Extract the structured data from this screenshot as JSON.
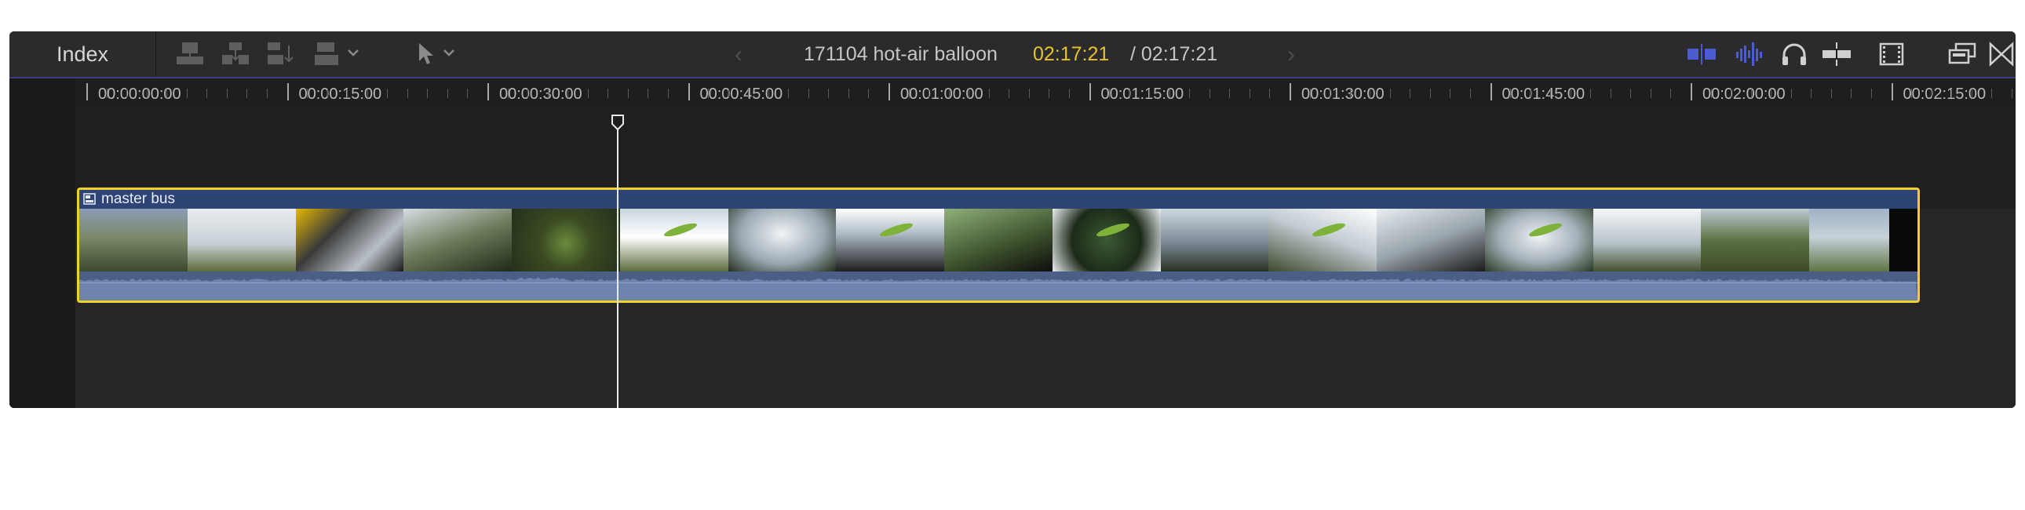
{
  "toolbar": {
    "index_label": "Index",
    "project_title": "171104 hot-air balloon",
    "timecode_current": "02:17:21",
    "timecode_total": "/ 02:17:21",
    "left_icons": [
      "connect-clip-icon",
      "insert-clip-icon",
      "append-clip-icon",
      "overwrite-clip-icon",
      "select-tool-icon"
    ],
    "right_icons": [
      "audio-lanes-icon",
      "waveform-icon",
      "headphones-icon",
      "skimming-icon",
      "filmstrip-icon",
      "clip-appearance-icon",
      "snapping-icon"
    ]
  },
  "ruler": {
    "labels": [
      "00:00:00:00",
      "00:00:15:00",
      "00:00:30:00",
      "00:00:45:00",
      "00:01:00:00",
      "00:01:15:00",
      "00:01:30:00",
      "00:01:45:00",
      "00:02:00:00",
      "00:02:15:00"
    ]
  },
  "clip": {
    "name": "master bus",
    "border_color": "#f2cf2a"
  },
  "colors": {
    "accent_yellow": "#e8c32a",
    "toolbar_blue_icons": "#4c5bd4",
    "clip_blue": "#2e4475"
  },
  "playhead": {
    "timecode": "00:00:40:00"
  }
}
